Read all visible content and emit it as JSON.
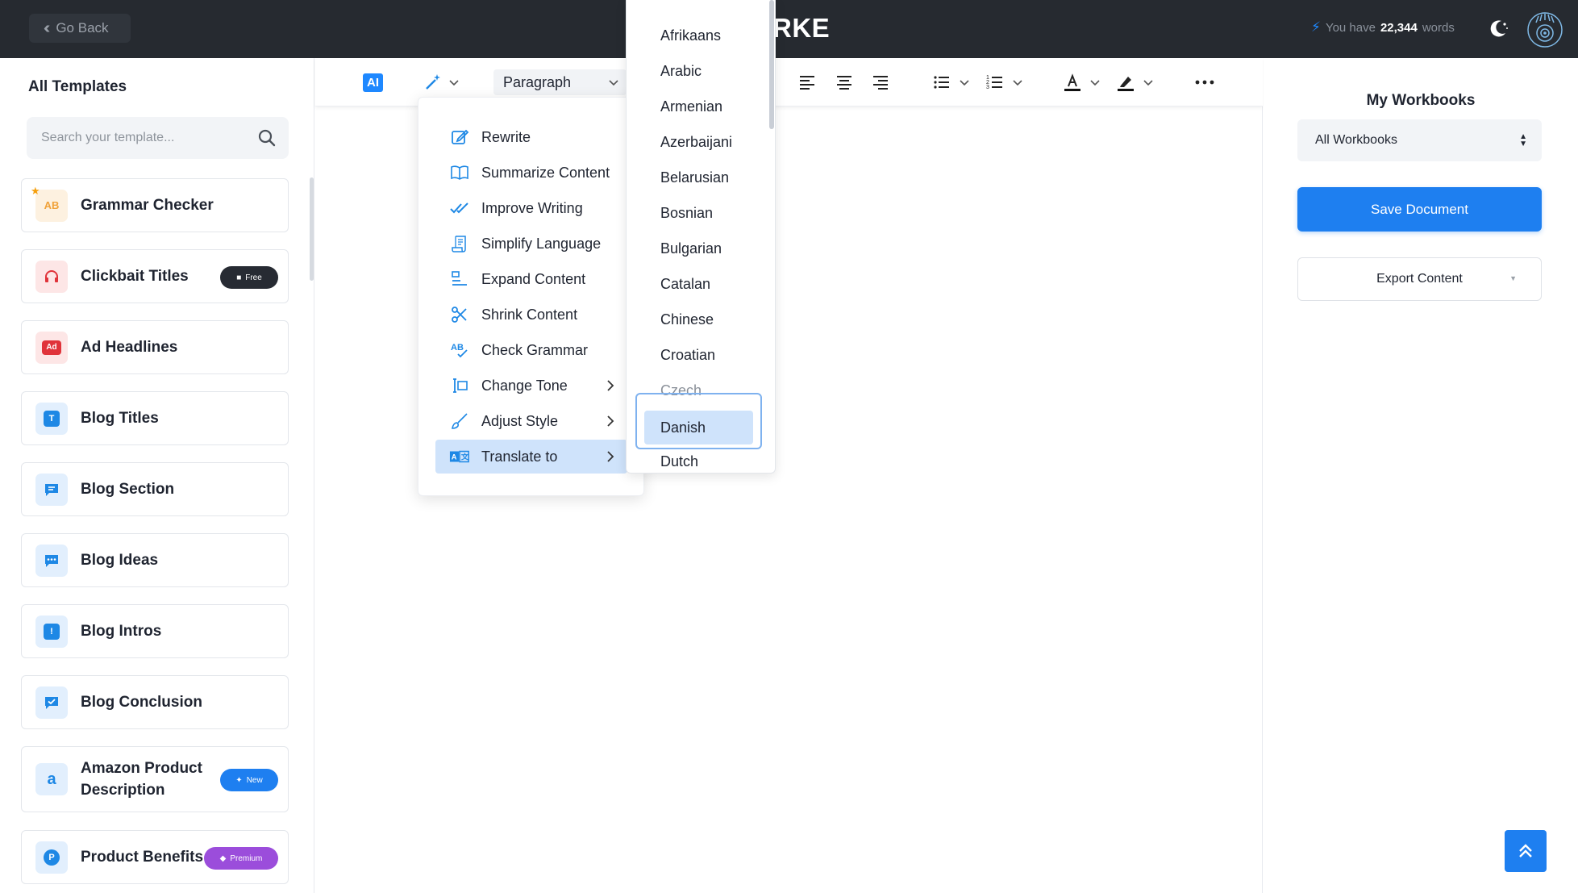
{
  "topbar": {
    "go_back": "Go Back",
    "brand": "RKE",
    "words_prefix": "You have",
    "words_count": "22,344",
    "words_suffix": "words"
  },
  "sidebar": {
    "title": "All Templates",
    "search_placeholder": "Search your template...",
    "templates": [
      {
        "label": "Grammar Checker",
        "icon": "grammar-icon"
      },
      {
        "label": "Clickbait Titles",
        "icon": "headphones-icon",
        "badge": "Free"
      },
      {
        "label": "Ad Headlines",
        "icon": "ad-icon",
        "icon_text": "Ad"
      },
      {
        "label": "Blog Titles",
        "icon": "title-icon",
        "icon_text": "T"
      },
      {
        "label": "Blog Section",
        "icon": "section-icon"
      },
      {
        "label": "Blog Ideas",
        "icon": "chat-icon"
      },
      {
        "label": "Blog Intros",
        "icon": "intro-icon",
        "icon_text": "!"
      },
      {
        "label": "Blog Conclusion",
        "icon": "check-icon"
      },
      {
        "label_line1": "Amazon Product",
        "label_line2": "Description",
        "icon": "amazon-icon",
        "icon_text": "a",
        "badge": "New"
      },
      {
        "label": "Product Benefits",
        "icon": "product-icon",
        "icon_text": "P",
        "badge": "Premium"
      }
    ]
  },
  "editor": {
    "ai_label": "AI",
    "paragraph": "Paragraph"
  },
  "ai_menu": {
    "items": [
      {
        "label": "Rewrite",
        "icon": "edit-icon"
      },
      {
        "label": "Summarize Content",
        "icon": "book-icon"
      },
      {
        "label": "Improve Writing",
        "icon": "double-check-icon"
      },
      {
        "label": "Simplify Language",
        "icon": "scroll-icon"
      },
      {
        "label": "Expand Content",
        "icon": "expand-icon"
      },
      {
        "label": "Shrink Content",
        "icon": "scissors-icon"
      },
      {
        "label": "Check Grammar",
        "icon": "spellcheck-icon"
      },
      {
        "label": "Change Tone",
        "icon": "text-cursor-icon",
        "submenu": true
      },
      {
        "label": "Adjust Style",
        "icon": "brush-icon",
        "submenu": true
      },
      {
        "label": "Translate to",
        "icon": "translate-icon",
        "submenu": true,
        "active": true
      }
    ]
  },
  "languages": {
    "items": [
      "Afrikaans",
      "Arabic",
      "Armenian",
      "Azerbaijani",
      "Belarusian",
      "Bosnian",
      "Bulgarian",
      "Catalan",
      "Chinese",
      "Croatian",
      "Czech"
    ],
    "selected": "Danish",
    "after": "Dutch"
  },
  "right_panel": {
    "title": "My Workbooks",
    "workbook_select": "All Workbooks",
    "save": "Save Document",
    "export": "Export Content"
  },
  "colors": {
    "accent": "#1e7ff0",
    "topbar": "#262a30",
    "menu_active": "#cfe3fb",
    "premium": "#9b4ddb"
  }
}
